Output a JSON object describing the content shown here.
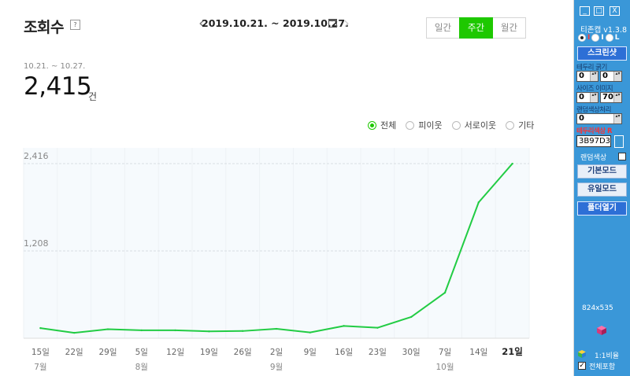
{
  "main": {
    "title": "조회수",
    "help_label": "?",
    "date_range": "2019.10.21. ~ 2019.10.27.",
    "period_tabs": [
      {
        "label": "일간",
        "active": false
      },
      {
        "label": "주간",
        "active": true
      },
      {
        "label": "월간",
        "active": false
      }
    ],
    "summary_range": "10.21. ~ 10.27.",
    "summary_value": "2,415",
    "summary_unit": "건",
    "filters": [
      {
        "label": "전체",
        "selected": true
      },
      {
        "label": "피이웃",
        "selected": false
      },
      {
        "label": "서로이웃",
        "selected": false
      },
      {
        "label": "기타",
        "selected": false
      }
    ]
  },
  "chart_data": {
    "type": "line",
    "color": "#22cc44",
    "x": [
      "15일",
      "22일",
      "29일",
      "5일",
      "12일",
      "19일",
      "26일",
      "2일",
      "9일",
      "16일",
      "23일",
      "30일",
      "7일",
      "14일",
      "21일"
    ],
    "month_labels": [
      "7월",
      "",
      "",
      "8월",
      "",
      "",
      "",
      "9월",
      "",
      "",
      "",
      "",
      "10월",
      "",
      ""
    ],
    "highlight_last": true,
    "series": [
      {
        "values": [
          140,
          75,
          125,
          110,
          110,
          95,
          100,
          130,
          80,
          170,
          145,
          295,
          630,
          1880,
          2415
        ]
      }
    ],
    "yticks": [
      2416,
      1208
    ],
    "ytick_labels": [
      "2,416",
      "1,208"
    ],
    "ylim": [
      0,
      2416
    ],
    "grid": true
  },
  "sidebar": {
    "window_buttons": [
      "_",
      "□",
      "X"
    ],
    "app_title": "티존캡 v1.3.8",
    "modes": [
      "I",
      "I",
      "L"
    ],
    "screenshot_btn": "스크린샷",
    "border_label": "테두리 굵기",
    "border_values": [
      "0",
      "0"
    ],
    "size_label": "사이즈 이미지",
    "size_values": [
      "0",
      "70"
    ],
    "random_label": "랜덤색상처리",
    "random_value": "0",
    "color_label": "테두리색상 R",
    "color_hex": "3B97D3",
    "swatch_color": "#3b97d3",
    "random_color_label": "랜덤색상",
    "basic_mode_btn": "기본모드",
    "user_mode_btn": "유일모드",
    "open_folder_btn": "폴더열기",
    "resolution": "824x535",
    "ratio_label": "1:1비율",
    "include_all_label": "전체포함"
  }
}
